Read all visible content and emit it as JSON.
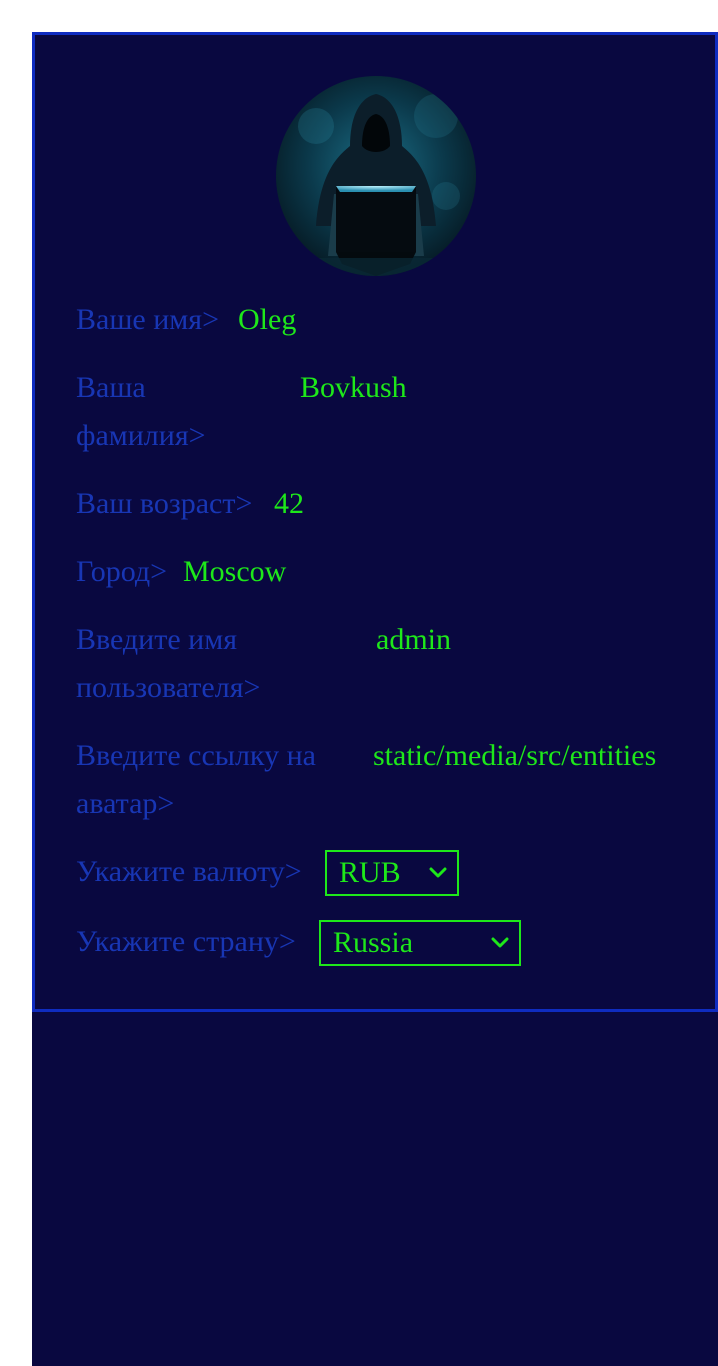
{
  "profile": {
    "avatar_alt": "hooded figure at laptop",
    "fields": [
      {
        "label": "Ваше имя>",
        "value": "Oleg"
      },
      {
        "label": "Ваша фамилия>",
        "value": "Bovkush"
      },
      {
        "label": "Ваш возраст>",
        "value": "42"
      },
      {
        "label": "Город>",
        "value": "Moscow"
      },
      {
        "label": "Введите имя пользователя>",
        "value": "admin"
      },
      {
        "label": "Введите ссылку на аватар>",
        "value": "static/media/src/entities"
      }
    ],
    "currency": {
      "label": "Укажите валюту>",
      "selected": "RUB"
    },
    "country": {
      "label": "Укажите страну>",
      "selected": "Russia"
    }
  },
  "icons": {
    "dropdown": "chevron-down-icon"
  },
  "colors": {
    "background": "#090840",
    "border": "#0f2cc0",
    "label": "#1836b4",
    "value": "#1ee81a"
  }
}
